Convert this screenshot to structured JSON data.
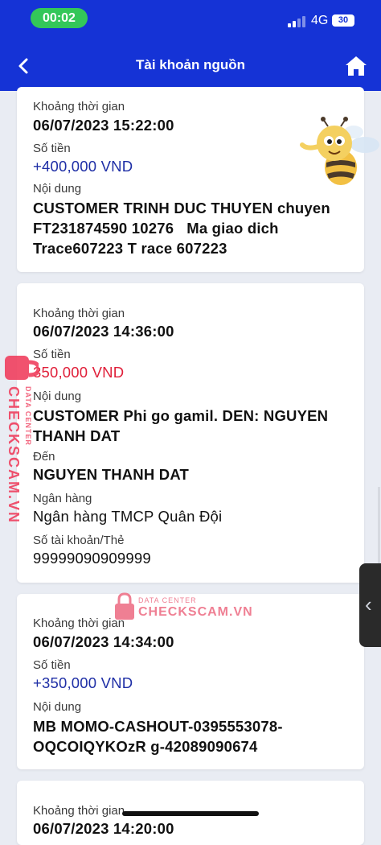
{
  "status_bar": {
    "time": "00:02",
    "network": "4G",
    "battery": "30"
  },
  "nav": {
    "title": "Tài khoản nguồn",
    "back_icon": "chevron-left-icon",
    "home_icon": "home-icon"
  },
  "labels": {
    "time": "Khoảng thời gian",
    "amount": "Số tiền",
    "content": "Nội dung",
    "to": "Đến",
    "bank": "Ngân hàng",
    "account": "Số tài khoản/Thẻ"
  },
  "transactions": [
    {
      "time": "06/07/2023 15:22:00",
      "amount": "+400,000 VND",
      "content": "CUSTOMER TRINH DUC THUYEN chuyen FT231874590 10276   Ma giao dich  Trace607223 T race 607223"
    },
    {
      "time": "06/07/2023 14:36:00",
      "amount": "350,000 VND",
      "content": "CUSTOMER Phi go gamil. DEN: NGUYEN THANH DAT",
      "to": "NGUYEN THANH DAT",
      "bank": "Ngân hàng TMCP Quân Đội",
      "account": "99999090909999"
    },
    {
      "time": "06/07/2023 14:34:00",
      "amount": "+350,000 VND",
      "content": "MB MOMO-CASHOUT-0395553078-OQCOIQYKOzR g-42089090674"
    },
    {
      "time": "06/07/2023 14:20:00"
    }
  ],
  "watermark": {
    "brand": "CHECKSCAM.VN",
    "sub": "DATA CENTER"
  },
  "colors": {
    "header": "#1533d6",
    "positive": "#1f2fa6",
    "negative": "#e0203a",
    "background": "#e9ecf3"
  }
}
